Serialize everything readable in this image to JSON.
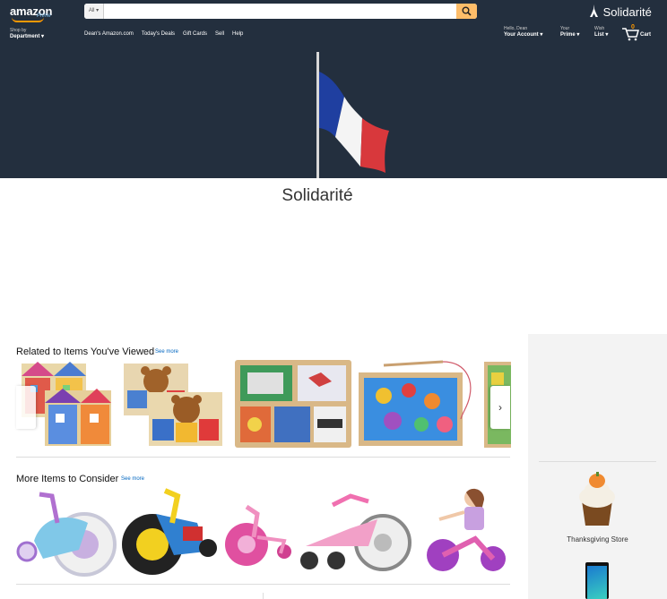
{
  "header": {
    "logo_text": "amazon",
    "logo_sub": "Prime",
    "search": {
      "category": "All",
      "placeholder": ""
    },
    "promo_text": "Solidarité",
    "shop_by": "Shop by",
    "department": "Department",
    "nav_links": [
      "Dean's Amazon.com",
      "Today's Deals",
      "Gift Cards",
      "Sell",
      "Help"
    ],
    "account": {
      "hello": "Hello, Dean",
      "label": "Your Account"
    },
    "prime": {
      "top": "Your",
      "label": "Prime"
    },
    "wishlist": {
      "top": "Wish",
      "label": "List"
    },
    "cart": {
      "count": "0",
      "label": "Cart"
    }
  },
  "hero": {
    "title": "Solidarité"
  },
  "carousel_related": {
    "title": "Related to Items You've Viewed",
    "see_more": "See more",
    "items": [
      "Dollhouse busy board",
      "Teddy bear activity board",
      "Wooden latches board",
      "Magnetic fishing puzzle",
      "Wooden puzzle (partial)"
    ]
  },
  "carousel_more": {
    "title": "More Items to Consider",
    "see_more": "See more",
    "items": [
      "Frozen big wheel tricycle",
      "Yellow big wheel tricycle",
      "Pink tricycle",
      "Pink big wheel",
      "Pink tricycle with girl"
    ]
  },
  "rail": {
    "store_label": "Thanksgiving Store"
  },
  "colors": {
    "header_bg": "#232f3e",
    "accent": "#febd69",
    "link": "#0066c0",
    "rail_bg": "#f3f3f3"
  }
}
